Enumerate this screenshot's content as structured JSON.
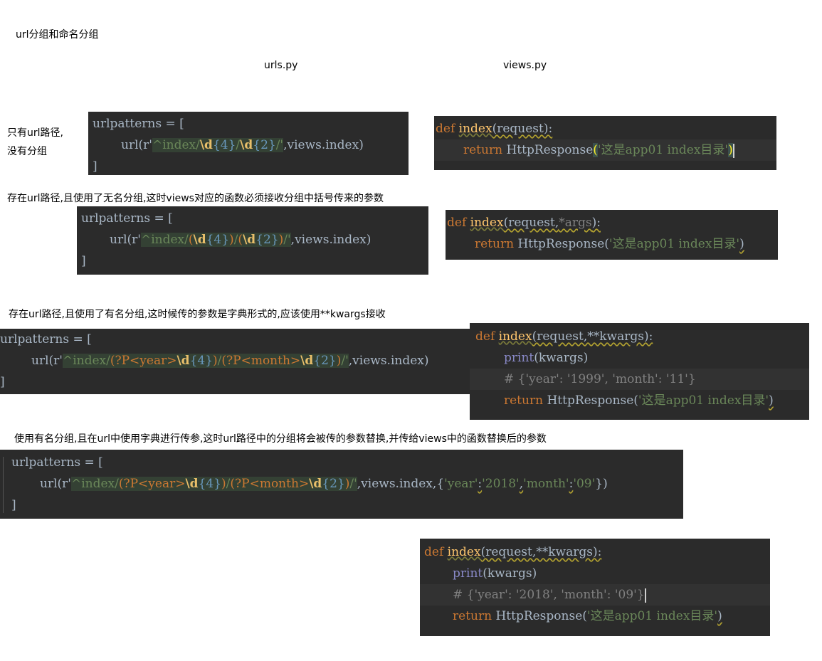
{
  "title": "url分组和命名分组",
  "col_urls": "urls.py",
  "col_views": "views.py",
  "sections": {
    "s1": {
      "label_line1": "只有url路径,",
      "label_line2": "没有分组",
      "urls": {
        "l1": "urlpatterns = [",
        "l2_pre": "url(r'",
        "l2_rx_a": "^index/",
        "l2_d1": "\\d",
        "l2_q1": "{4}",
        "l2_sep": "/",
        "l2_d2": "\\d",
        "l2_q2": "{2}",
        "l2_rx_b": "/'",
        "l2_post": ",views.index)",
        "l3": "]"
      },
      "views": {
        "def": "def",
        "fname": "index",
        "sig": "(request):",
        "ret": "return",
        "call": "HttpResponse",
        "open": "(",
        "str": "'这是app01 index目录'",
        "close": ")"
      }
    },
    "s2": {
      "label": "存在url路径,且使用了无名分组,这时views对应的函数必须接收分组中括号传来的参数",
      "urls": {
        "l1": "urlpatterns = [",
        "l2_pre": "url(r'",
        "l2_rx_a": "^index/",
        "l2_g1o": "(",
        "l2_d1": "\\d",
        "l2_q1": "{4}",
        "l2_g1c": ")",
        "l2_sep": "/",
        "l2_g2o": "(",
        "l2_d2": "\\d",
        "l2_q2": "{2}",
        "l2_g2c": ")",
        "l2_rx_b": "/'",
        "l2_post": ",views.index)",
        "l3": "]"
      },
      "views": {
        "def": "def",
        "fname": "index",
        "sig_a": "(request,",
        "sig_star": "*args",
        "sig_b": "):",
        "ret": "return",
        "call": "HttpResponse(",
        "str": "'这是app01 index目录'",
        "close": ")"
      }
    },
    "s3": {
      "label": "存在url路径,且使用了有名分组,这时候传的参数是字典形式的,应该使用**kwargs接收",
      "urls": {
        "l1": "urlpatterns = [",
        "l2_pre": "url(r'",
        "l2_rx_a": "^index/",
        "l2_g1o": "(?P<year>",
        "l2_d1": "\\d",
        "l2_q1": "{4}",
        "l2_g1c": ")",
        "l2_sep": "/",
        "l2_g2o": "(?P<month>",
        "l2_d2": "\\d",
        "l2_q2": "{2}",
        "l2_g2c": ")",
        "l2_rx_b": "/'",
        "l2_post": ",views.index)",
        "l3": "]"
      },
      "views": {
        "def": "def",
        "fname": "index",
        "sig": "(request,**kwargs):",
        "print": "print",
        "print_arg": "(kwargs)",
        "comment": "# {'year': '1999', 'month': '11'}",
        "ret": "return",
        "call": "HttpResponse(",
        "str": "'这是app01 index目录'",
        "close": ")"
      }
    },
    "s4": {
      "label": "使用有名分组,且在url中使用字典进行传参,这时url路径中的分组将会被传的参数替换,并传给views中的函数替换后的参数",
      "urls": {
        "l1": "urlpatterns = [",
        "l2_pre": "url(r'",
        "l2_rx_a": "^index/",
        "l2_g1o": "(?P<year>",
        "l2_d1": "\\d",
        "l2_q1": "{4}",
        "l2_g1c": ")",
        "l2_sep": "/",
        "l2_g2o": "(?P<month>",
        "l2_d2": "\\d",
        "l2_q2": "{2}",
        "l2_g2c": ")",
        "l2_rx_b": "/'",
        "l2_mid": ",views.index,{",
        "l2_k1": "'year'",
        "l2_c1": ":",
        "l2_v1": "'2018'",
        "l2_comma": ",",
        "l2_k2": "'month'",
        "l2_c2": ":",
        "l2_v2": "'09'",
        "l2_end": "})",
        "l3": "]"
      },
      "views": {
        "def": "def",
        "fname": "index",
        "sig": "(request,**kwargs):",
        "print": "print",
        "print_arg": "(kwargs)",
        "comment": "# {'year': '2018', 'month': '09'}",
        "ret": "return",
        "call": "HttpResponse(",
        "str": "'这是app01 index目录'",
        "close": ")"
      }
    }
  },
  "colors": {
    "editor_bg": "#2b2b2b",
    "keyword": "#cc7832",
    "function": "#ffc66d",
    "string": "#6a8759",
    "number": "#6897bb",
    "comment": "#808080"
  }
}
